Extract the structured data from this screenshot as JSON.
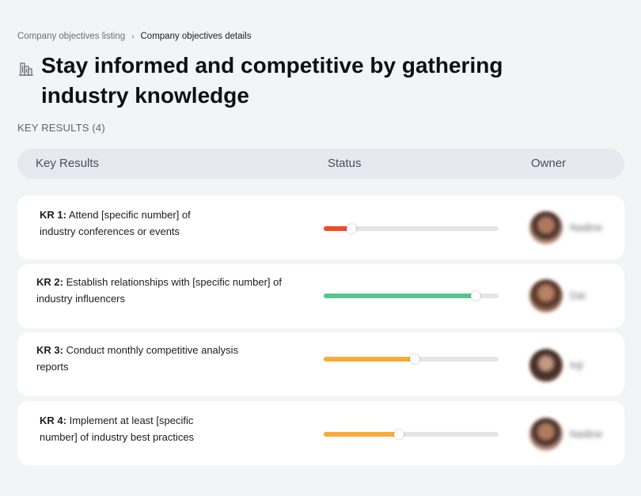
{
  "breadcrumb": {
    "parent": "Company objectives listing",
    "separator": "›",
    "current": "Company objectives details"
  },
  "objective": {
    "icon": "buildings-icon",
    "title": "Stay informed and competitive by gathering industry knowledge"
  },
  "key_results_label": "KEY RESULTS (4)",
  "table": {
    "headers": {
      "key_results": "Key Results",
      "status": "Status",
      "owner": "Owner"
    }
  },
  "key_results": [
    {
      "tag": "KR 1:",
      "line1": "Attend [specific number] of",
      "line2": "industry conferences or events",
      "progress": 0.16,
      "color": "#f04a2a",
      "owner": "Nadine"
    },
    {
      "tag": "KR 2:",
      "line1": "Establish relationships with [specific number] of",
      "line2": "industry influencers",
      "progress": 0.87,
      "color": "#56c58d",
      "owner": "Dai"
    },
    {
      "tag": "KR 3:",
      "line1": "Conduct monthly competitive analysis",
      "line2": "reports",
      "progress": 0.52,
      "color": "#fbab38",
      "owner": "Inji"
    },
    {
      "tag": "KR 4:",
      "line1": "Implement at least [specific",
      "line2": "number] of industry best practices",
      "progress": 0.43,
      "color": "#fbab38",
      "owner": "Nadine"
    }
  ],
  "colors": {
    "background": "#f3f4f6",
    "header_bar": "#e7e9f0",
    "card": "#ffffff",
    "track": "#e5e5e5"
  }
}
